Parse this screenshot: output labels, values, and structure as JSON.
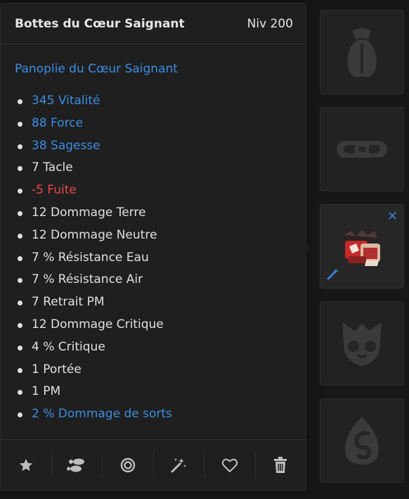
{
  "item": {
    "name": "Bottes du Cœur Saignant",
    "level": "Niv 200",
    "set_name": "Panoplie du Cœur Saignant"
  },
  "stats": [
    {
      "text": "345 Vitalité",
      "color": "blue"
    },
    {
      "text": "88 Force",
      "color": "blue"
    },
    {
      "text": "38 Sagesse",
      "color": "blue"
    },
    {
      "text": "7 Tacle",
      "color": "white"
    },
    {
      "text": "-5 Fuite",
      "color": "red"
    },
    {
      "text": "12 Dommage Terre",
      "color": "white"
    },
    {
      "text": "12 Dommage Neutre",
      "color": "white"
    },
    {
      "text": "7 % Résistance Eau",
      "color": "white"
    },
    {
      "text": "7 % Résistance Air",
      "color": "white"
    },
    {
      "text": "7 Retrait PM",
      "color": "white"
    },
    {
      "text": "12 Dommage Critique",
      "color": "white"
    },
    {
      "text": "4 % Critique",
      "color": "white"
    },
    {
      "text": "1 Portée",
      "color": "white"
    },
    {
      "text": "1 PM",
      "color": "white"
    },
    {
      "text": "2 % Dommage de sorts",
      "color": "blue"
    }
  ],
  "footer_actions": [
    "star-icon",
    "footsteps-icon",
    "target-icon",
    "magic-wand-icon",
    "heart-icon",
    "trash-icon"
  ],
  "slots": [
    "amulet-slot",
    "belt-slot",
    "boots-slot",
    "pet-slot",
    "dofus-slot"
  ],
  "colors": {
    "accent_blue": "#3b8de3",
    "negative_red": "#e64848",
    "text": "#e0e0e0"
  }
}
